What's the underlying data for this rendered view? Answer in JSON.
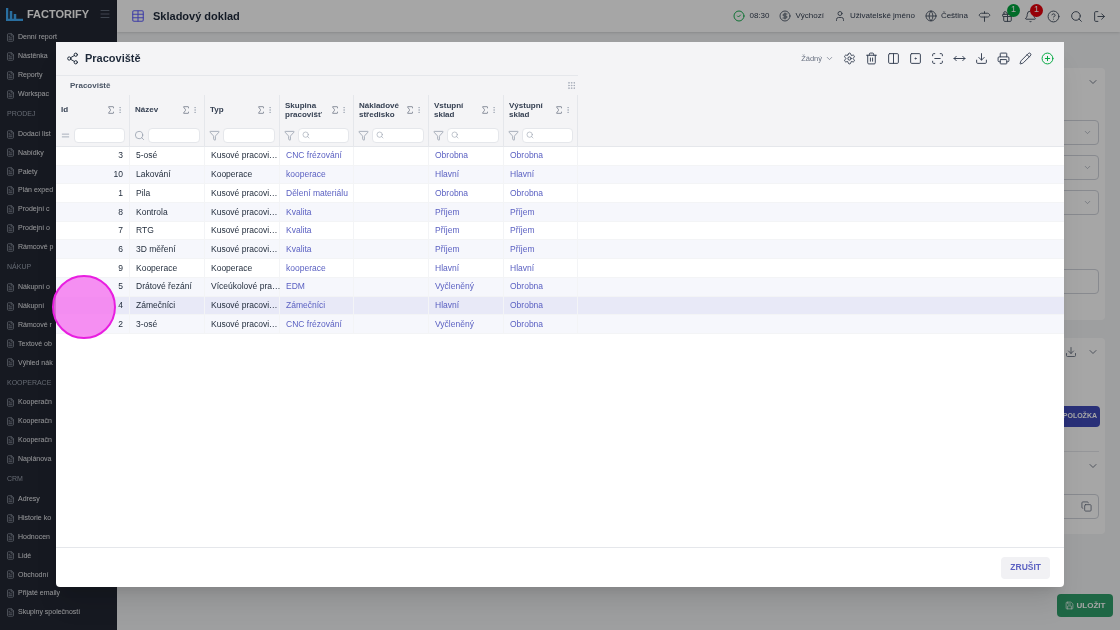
{
  "sidebar": {
    "logo": "FACTORIFY",
    "items": [
      {
        "kind": "item",
        "label": "Denní report"
      },
      {
        "kind": "item",
        "label": "Nástěnka"
      },
      {
        "kind": "item",
        "label": "Reporty"
      },
      {
        "kind": "item",
        "label": "Workspac"
      },
      {
        "kind": "section",
        "label": "PRODEJ"
      },
      {
        "kind": "item",
        "label": "Dodací list"
      },
      {
        "kind": "item",
        "label": "Nabídky"
      },
      {
        "kind": "item",
        "label": "Palety"
      },
      {
        "kind": "item",
        "label": "Plán exped"
      },
      {
        "kind": "item",
        "label": "Prodejní c"
      },
      {
        "kind": "item",
        "label": "Prodejní o"
      },
      {
        "kind": "item",
        "label": "Rámcové p"
      },
      {
        "kind": "section",
        "label": "NÁKUP"
      },
      {
        "kind": "item",
        "label": "Nákupní o"
      },
      {
        "kind": "item",
        "label": "Nákupní"
      },
      {
        "kind": "item",
        "label": "Rámcové r"
      },
      {
        "kind": "item",
        "label": "Textové ob"
      },
      {
        "kind": "item",
        "label": "Výhled nák"
      },
      {
        "kind": "section",
        "label": "KOOPERACE"
      },
      {
        "kind": "item",
        "label": "Kooperačn"
      },
      {
        "kind": "item",
        "label": "Kooperačn"
      },
      {
        "kind": "item",
        "label": "Kooperačn"
      },
      {
        "kind": "item",
        "label": "Naplánova"
      },
      {
        "kind": "section",
        "label": "CRM"
      },
      {
        "kind": "item",
        "label": "Adresy"
      },
      {
        "kind": "item",
        "label": "Historie ko"
      },
      {
        "kind": "item",
        "label": "Hodnocen"
      },
      {
        "kind": "item",
        "label": "Lidé"
      },
      {
        "kind": "item",
        "label": "Obchodní"
      },
      {
        "kind": "item",
        "label": "Přijaté emaily"
      },
      {
        "kind": "item",
        "label": "Skupiny společností"
      }
    ]
  },
  "topbar": {
    "title": "Skladový doklad",
    "time": "08:30",
    "shift": "Výchozí",
    "user": "Uživatelské jméno",
    "language": "Čeština",
    "gift_badge": "1",
    "bell_badge": "1"
  },
  "background": {
    "add_button": "POLOŽKA",
    "save_button": "ULOŽIT"
  },
  "modal": {
    "title": "Pracoviště",
    "view_select": "Žádný",
    "group_label": "Pracoviště",
    "columns": [
      {
        "label": "Id",
        "kind": "equals"
      },
      {
        "label": "Název",
        "kind": "search"
      },
      {
        "label": "Typ",
        "kind": "funnel"
      },
      {
        "label": "Skupina pracovišť",
        "kind": "funnel_search"
      },
      {
        "label": "Nákladové středisko",
        "kind": "funnel_search"
      },
      {
        "label": "Vstupní sklad",
        "kind": "funnel_search"
      },
      {
        "label": "Výstupní sklad",
        "kind": "funnel_search"
      }
    ],
    "rows": [
      {
        "id": "3",
        "name": "5-osé",
        "type": "Kusové pracovi…",
        "group": "CNC frézování",
        "input_store": "Obrobna",
        "output_store": "Obrobna",
        "selected": false
      },
      {
        "id": "10",
        "name": "Lakování",
        "type": "Kooperace",
        "group": "kooperace",
        "input_store": "Hlavní",
        "output_store": "Hlavní",
        "selected": false
      },
      {
        "id": "1",
        "name": "Pila",
        "type": "Kusové pracovi…",
        "group": "Dělení materiálu",
        "input_store": "Obrobna",
        "output_store": "Obrobna",
        "selected": false
      },
      {
        "id": "8",
        "name": "Kontrola",
        "type": "Kusové pracovi…",
        "group": "Kvalita",
        "input_store": "Příjem",
        "output_store": "Příjem",
        "selected": false
      },
      {
        "id": "7",
        "name": "RTG",
        "type": "Kusové pracovi…",
        "group": "Kvalita",
        "input_store": "Příjem",
        "output_store": "Příjem",
        "selected": false
      },
      {
        "id": "6",
        "name": "3D měření",
        "type": "Kusové pracovi…",
        "group": "Kvalita",
        "input_store": "Příjem",
        "output_store": "Příjem",
        "selected": false
      },
      {
        "id": "9",
        "name": "Kooperace",
        "type": "Kooperace",
        "group": "kooperace",
        "input_store": "Hlavní",
        "output_store": "Hlavní",
        "selected": false
      },
      {
        "id": "5",
        "name": "Drátové řezání",
        "type": "Víceúkolové pra…",
        "group": "EDM",
        "input_store": "Vyčleněný",
        "output_store": "Obrobna",
        "selected": false
      },
      {
        "id": "4",
        "name": "Zámečníci",
        "type": "Kusové pracovi…",
        "group": "Zámečníci",
        "input_store": "Hlavní",
        "output_store": "Obrobna",
        "selected": true
      },
      {
        "id": "2",
        "name": "3-osé",
        "type": "Kusové pracovi…",
        "group": "CNC frézování",
        "input_store": "Vyčleněný",
        "output_store": "Obrobna",
        "selected": false
      }
    ],
    "cancel_button": "ZRUŠIT"
  }
}
